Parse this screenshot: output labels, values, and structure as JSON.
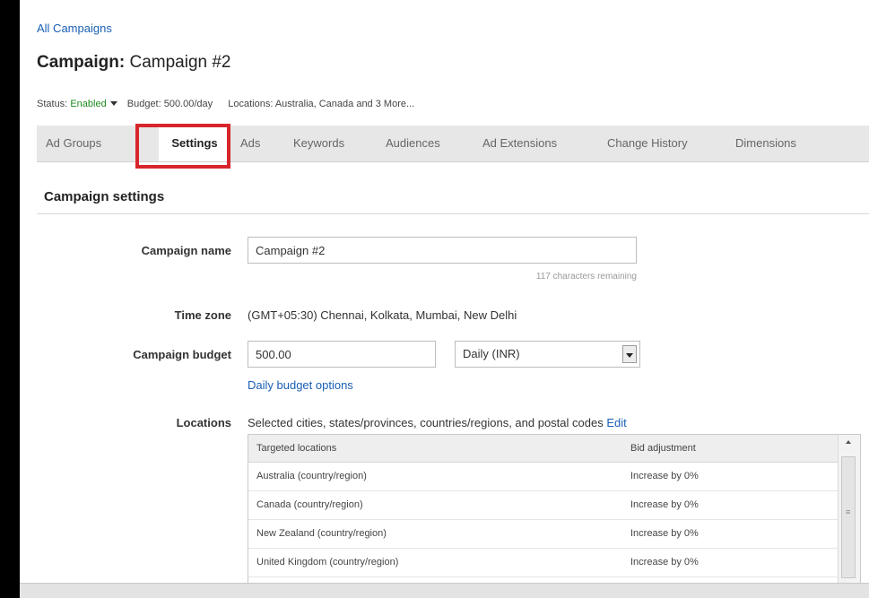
{
  "breadcrumb": "All Campaigns",
  "header": {
    "title_label": "Campaign:",
    "title_name": "Campaign #2"
  },
  "status": {
    "label": "Status:",
    "value": "Enabled",
    "budget": "Budget: 500.00/day",
    "locations": "Locations: Australia, Canada and 3 More..."
  },
  "tabs": [
    {
      "label": "Ad Groups"
    },
    {
      "label": "Settings",
      "active": true
    },
    {
      "label": "Ads"
    },
    {
      "label": "Keywords"
    },
    {
      "label": "Audiences"
    },
    {
      "label": "Ad Extensions"
    },
    {
      "label": "Change History"
    },
    {
      "label": "Dimensions"
    }
  ],
  "section_title": "Campaign settings",
  "form": {
    "campaign_name": {
      "label": "Campaign name",
      "value": "Campaign #2",
      "hint": "117 characters remaining"
    },
    "time_zone": {
      "label": "Time zone",
      "value": "(GMT+05:30) Chennai, Kolkata, Mumbai, New Delhi"
    },
    "budget": {
      "label": "Campaign budget",
      "value": "500.00",
      "period": "Daily (INR)",
      "options_link": "Daily budget options"
    },
    "locations": {
      "label": "Locations",
      "summary": "Selected cities, states/provinces, countries/regions, and postal codes",
      "edit": "Edit",
      "col_location": "Targeted locations",
      "col_bid": "Bid adjustment",
      "rows": [
        {
          "location": "Australia (country/region)",
          "bid": "Increase by 0%"
        },
        {
          "location": "Canada (country/region)",
          "bid": "Increase by 0%"
        },
        {
          "location": "New Zealand (country/region)",
          "bid": "Increase by 0%"
        },
        {
          "location": "United Kingdom (country/region)",
          "bid": "Increase by 0%"
        }
      ]
    }
  },
  "colors": {
    "link": "#1a5fb4",
    "enabled": "#1e8a1e",
    "highlight": "#d7262b"
  }
}
